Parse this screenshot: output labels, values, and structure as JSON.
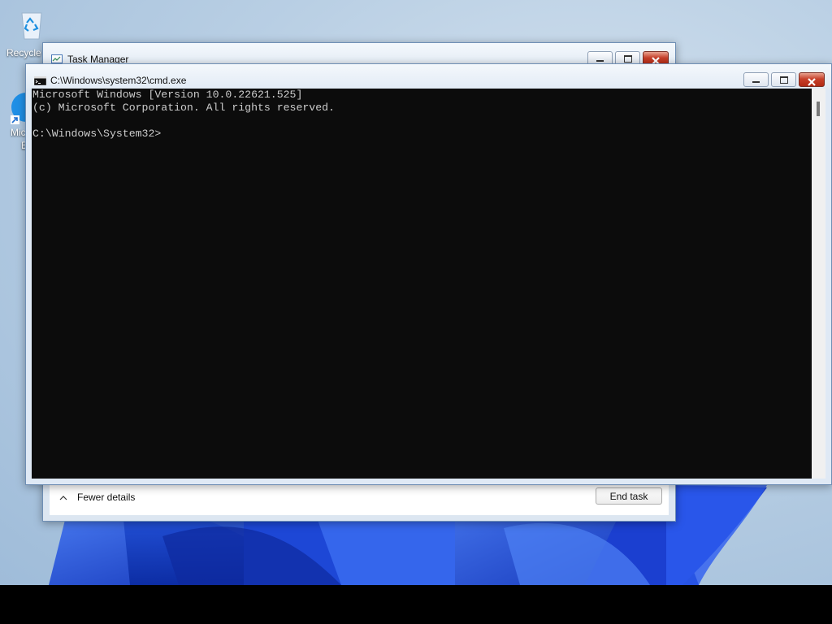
{
  "desktop": {
    "icons": [
      {
        "label": "Recycle",
        "icon": "recycle-bin-icon"
      },
      {
        "label": "Mic",
        "sublabel": "E",
        "icon": "edge-shortcut-icon"
      }
    ]
  },
  "task_manager": {
    "title": "Task Manager",
    "fewer_details_label": "Fewer details",
    "end_task_label": "End task"
  },
  "cmd": {
    "title": "C:\\Windows\\system32\\cmd.exe",
    "lines": [
      "Microsoft Windows [Version 10.0.22621.525]",
      "(c) Microsoft Corporation. All rights reserved.",
      "",
      "C:\\Windows\\System32>"
    ]
  },
  "colors": {
    "console_bg": "#0c0c0c",
    "console_text": "#cccccc",
    "close_button": "#c7402a",
    "wallpaper_blue": "#1d47d6"
  }
}
